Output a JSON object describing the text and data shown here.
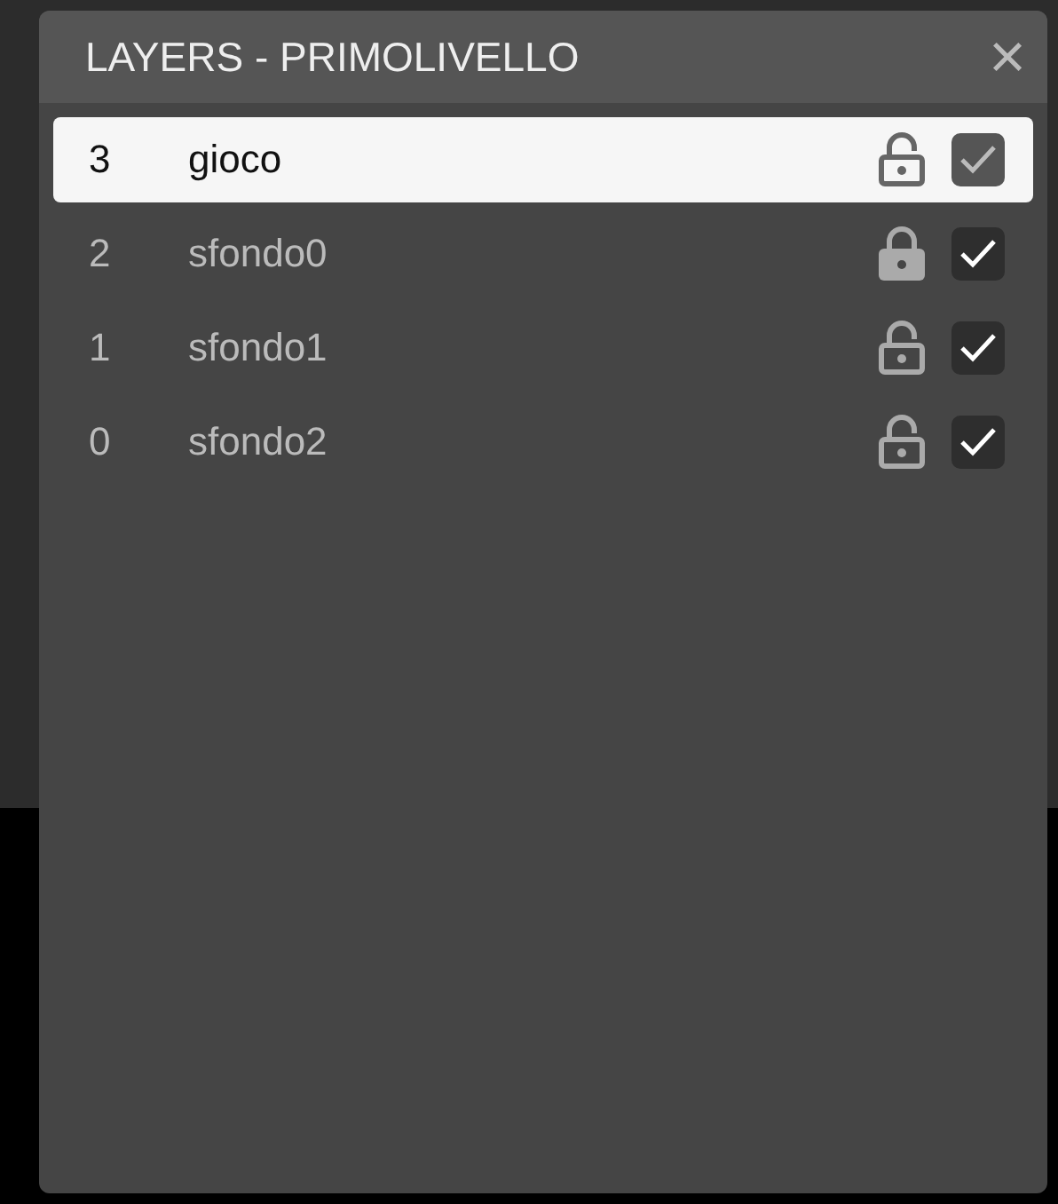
{
  "panel": {
    "title": "LAYERS - PRIMOLIVELLO",
    "close": "×"
  },
  "layers": [
    {
      "index": "3",
      "name": "gioco",
      "selected": true,
      "locked": false,
      "visible": true
    },
    {
      "index": "2",
      "name": "sfondo0",
      "selected": false,
      "locked": true,
      "visible": true
    },
    {
      "index": "1",
      "name": "sfondo1",
      "selected": false,
      "locked": false,
      "visible": true
    },
    {
      "index": "0",
      "name": "sfondo2",
      "selected": false,
      "locked": false,
      "visible": true
    }
  ]
}
